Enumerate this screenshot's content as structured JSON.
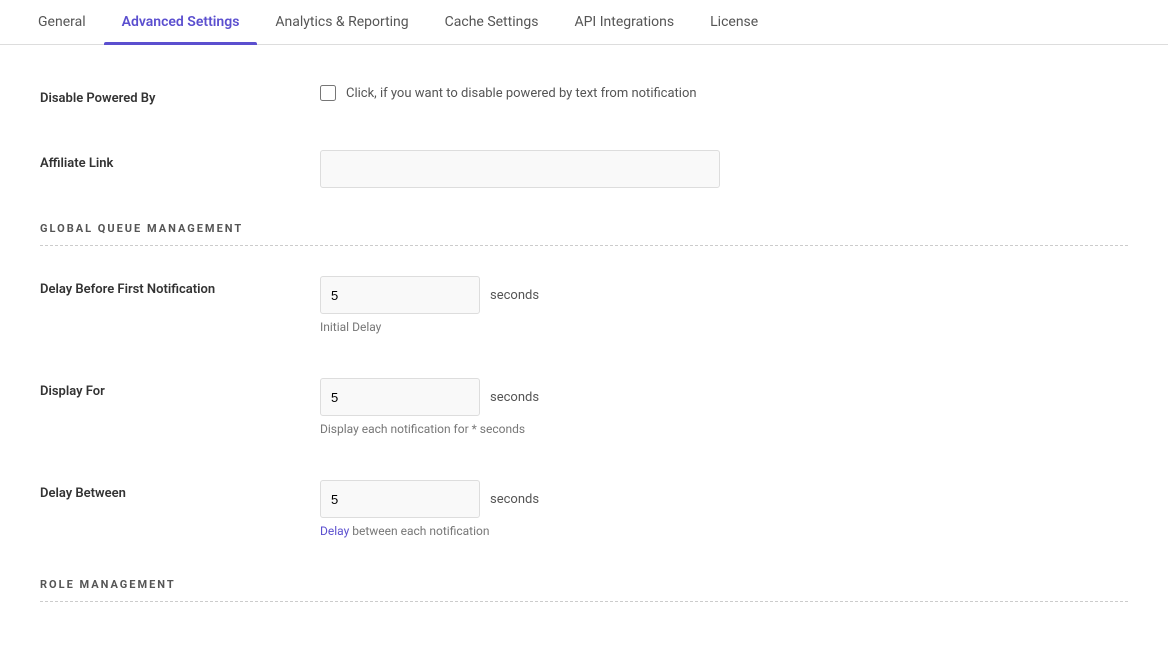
{
  "tabs": [
    {
      "id": "general",
      "label": "General",
      "active": false
    },
    {
      "id": "advanced-settings",
      "label": "Advanced Settings",
      "active": true
    },
    {
      "id": "analytics-reporting",
      "label": "Analytics & Reporting",
      "active": false
    },
    {
      "id": "cache-settings",
      "label": "Cache Settings",
      "active": false
    },
    {
      "id": "api-integrations",
      "label": "API Integrations",
      "active": false
    },
    {
      "id": "license",
      "label": "License",
      "active": false
    }
  ],
  "fields": {
    "disable_powered_by": {
      "label": "Disable Powered By",
      "checkbox_hint": "Click, if you want to disable powered by text from notification"
    },
    "affiliate_link": {
      "label": "Affiliate Link",
      "placeholder": ""
    }
  },
  "sections": {
    "global_queue": {
      "title": "GLOBAL QUEUE MANAGEMENT",
      "delay_before_first": {
        "label": "Delay Before First Notification",
        "value": "5",
        "unit": "seconds",
        "hint": "Initial Delay"
      },
      "display_for": {
        "label": "Display For",
        "value": "5",
        "unit": "seconds",
        "hint": "Display each notification for * seconds"
      },
      "delay_between": {
        "label": "Delay Between",
        "value": "5",
        "unit": "seconds",
        "hint_prefix": "Delay",
        "hint_middle": " between each notification"
      }
    },
    "role_management": {
      "title": "ROLE MANAGEMENT"
    }
  }
}
